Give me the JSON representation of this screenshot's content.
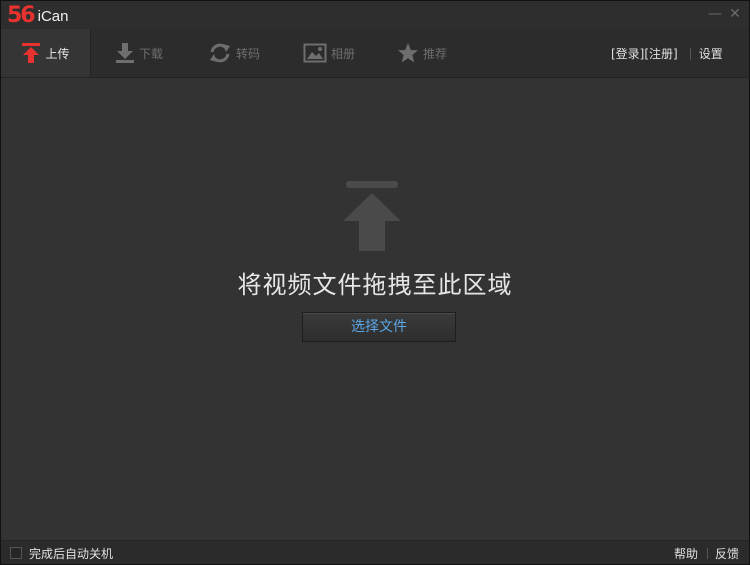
{
  "titlebar": {
    "logo_mark": "56",
    "app_name": "iCan",
    "minimize_glyph": "—",
    "close_glyph": "✕"
  },
  "toolbar": {
    "tabs": [
      {
        "label": "上传",
        "icon": "upload-arrow-icon",
        "active": true
      },
      {
        "label": "下载",
        "icon": "download-arrow-icon",
        "active": false
      },
      {
        "label": "转码",
        "icon": "convert-refresh-icon",
        "active": false
      },
      {
        "label": "相册",
        "icon": "album-image-icon",
        "active": false
      },
      {
        "label": "推荐",
        "icon": "star-icon",
        "active": false
      }
    ],
    "login_label": "[登录]",
    "register_label": "[注册]",
    "settings_label": "设置"
  },
  "main": {
    "drop_hint": "将视频文件拖拽至此区域",
    "select_button_label": "选择文件"
  },
  "statusbar": {
    "auto_shutdown_label": "完成后自动关机",
    "auto_shutdown_checked": false,
    "help_label": "帮助",
    "feedback_label": "反馈"
  },
  "colors": {
    "brand_red": "#e8322f",
    "accent_blue": "#5aa6e6",
    "background": "#333333"
  }
}
